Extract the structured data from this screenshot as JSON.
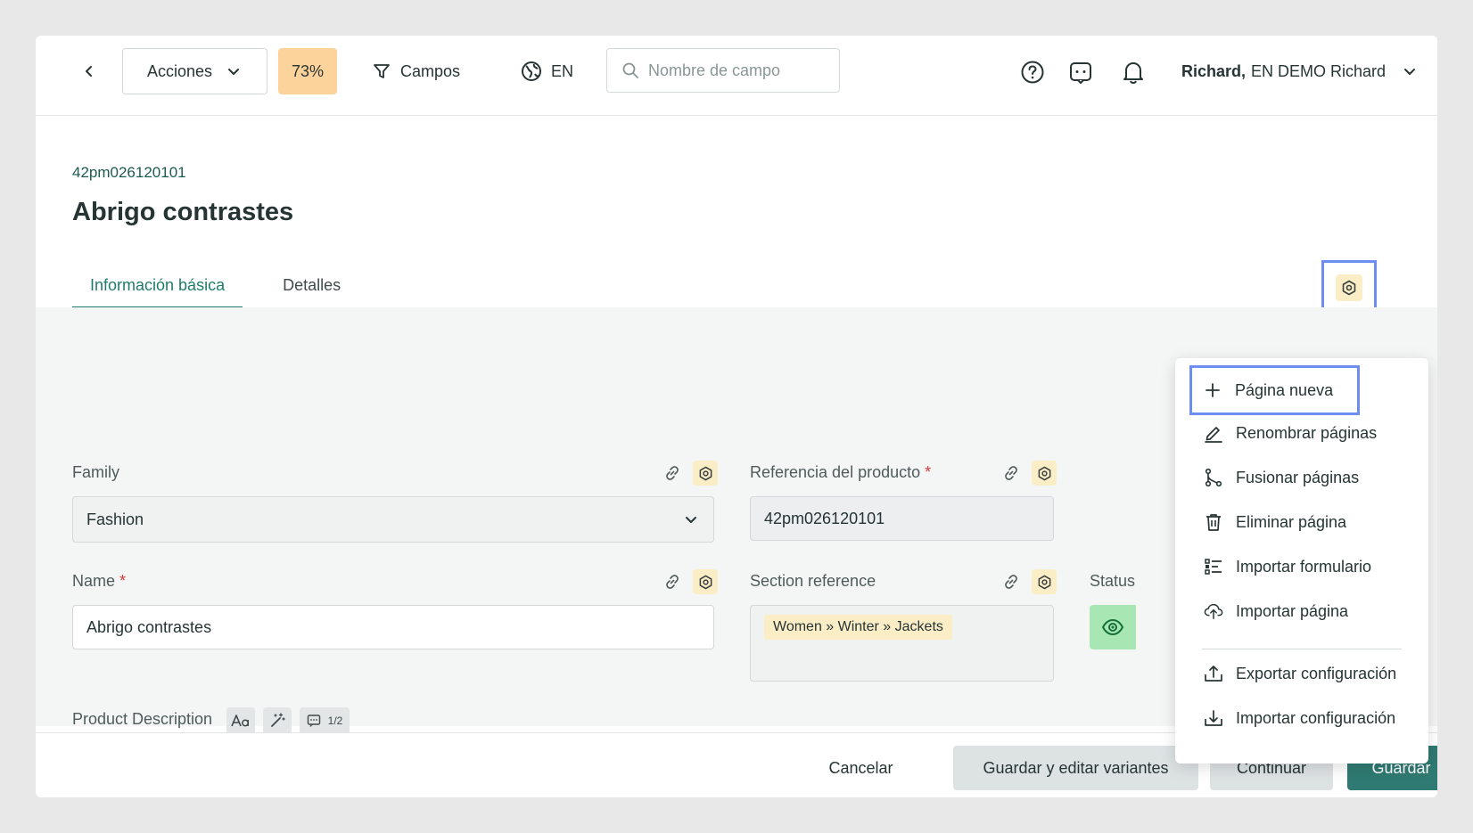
{
  "topbar": {
    "acciones_label": "Acciones",
    "completion": "73%",
    "campos_label": "Campos",
    "language": "EN",
    "search_placeholder": "Nombre de campo",
    "user_name": "Richard,",
    "user_company": "EN DEMO Richard"
  },
  "product": {
    "sku": "42pm026120101",
    "title": "Abrigo contrastes"
  },
  "tabs": [
    {
      "label": "Información básica",
      "active": true
    },
    {
      "label": "Detalles",
      "active": false
    }
  ],
  "fields": {
    "family_label": "Family",
    "family_value": "Fashion",
    "ref_label": "Referencia del producto",
    "ref_value": "42pm026120101",
    "name_label": "Name",
    "name_value": "Abrigo contrastes",
    "section_label": "Section reference",
    "section_value": "Women » Winter » Jackets",
    "status_label": "Status",
    "required_mark": "*",
    "description_label": "Product Description",
    "description_comment_count": "1/2"
  },
  "menu": {
    "items": [
      {
        "label": "Página nueva",
        "icon": "plus-icon"
      },
      {
        "label": "Renombrar páginas",
        "icon": "pencil-icon"
      },
      {
        "label": "Fusionar páginas",
        "icon": "merge-icon"
      },
      {
        "label": "Eliminar página",
        "icon": "trash-icon"
      },
      {
        "label": "Importar formulario",
        "icon": "form-list-icon"
      },
      {
        "label": "Importar página",
        "icon": "cloud-upload-icon"
      },
      {
        "label": "Exportar configuración",
        "icon": "export-icon"
      },
      {
        "label": "Importar configuración",
        "icon": "import-icon"
      }
    ]
  },
  "footer": {
    "cancel": "Cancelar",
    "save_edit_variants": "Guardar y editar variantes",
    "continue": "Continuar",
    "save": "Guardar"
  },
  "colors": {
    "accent": "#2f7a72",
    "tab_active": "#1f7c6a",
    "completion_bg": "#fcd39a",
    "chip_bg": "#fbeec7",
    "focus_outline": "#6e8df0",
    "status_green": "#a8e6b4",
    "required": "#d83a3a"
  }
}
